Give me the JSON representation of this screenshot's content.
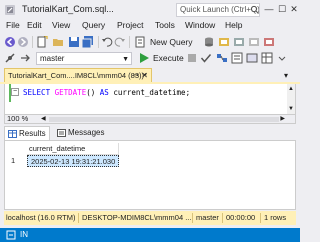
{
  "window": {
    "title": "TutorialKart_Com.sql...",
    "quick_launch_placeholder": "Quick Launch (Ctrl+Q)",
    "controls": {
      "minimize": "—",
      "maximize": "☐",
      "close": "✕"
    }
  },
  "menu": [
    "File",
    "Edit",
    "View",
    "Query",
    "Project",
    "Tools",
    "Window",
    "Help"
  ],
  "toolbar": {
    "new_query_label": "New Query",
    "database": "master",
    "execute_label": "Execute"
  },
  "document_tab": {
    "title": "TutorialKart_Com....IM8CL\\mmm04 (83))*",
    "pin": "⊸",
    "close": "✕"
  },
  "editor": {
    "collapse_glyph": "−",
    "code": {
      "kw1": "SELECT",
      "fn": "GETDATE",
      "parens": "()",
      "kw2": "AS",
      "ident": "current_datetime",
      "semicolon": ";"
    },
    "zoom": "100 %"
  },
  "results": {
    "tabs": [
      "Results",
      "Messages"
    ],
    "columns": [
      "current_datetime"
    ],
    "rows": [
      {
        "row_num": "1",
        "values": [
          "2025-02-13 19:31:21.030"
        ]
      }
    ]
  },
  "status_bar": {
    "server": "localhost (16.0 RTM)",
    "connection": "DESKTOP-MDIM8CL\\mmm04 ...",
    "database": "master",
    "elapsed": "00:00:00",
    "rows": "1 rows"
  },
  "app_status": {
    "text": "IN"
  },
  "colors": {
    "accent_blue": "#007acc",
    "tab_yellow": "#fff0b7",
    "selected_cell": "#cde8ff",
    "keyword": "#0000ff",
    "function": "#ff00ff"
  }
}
